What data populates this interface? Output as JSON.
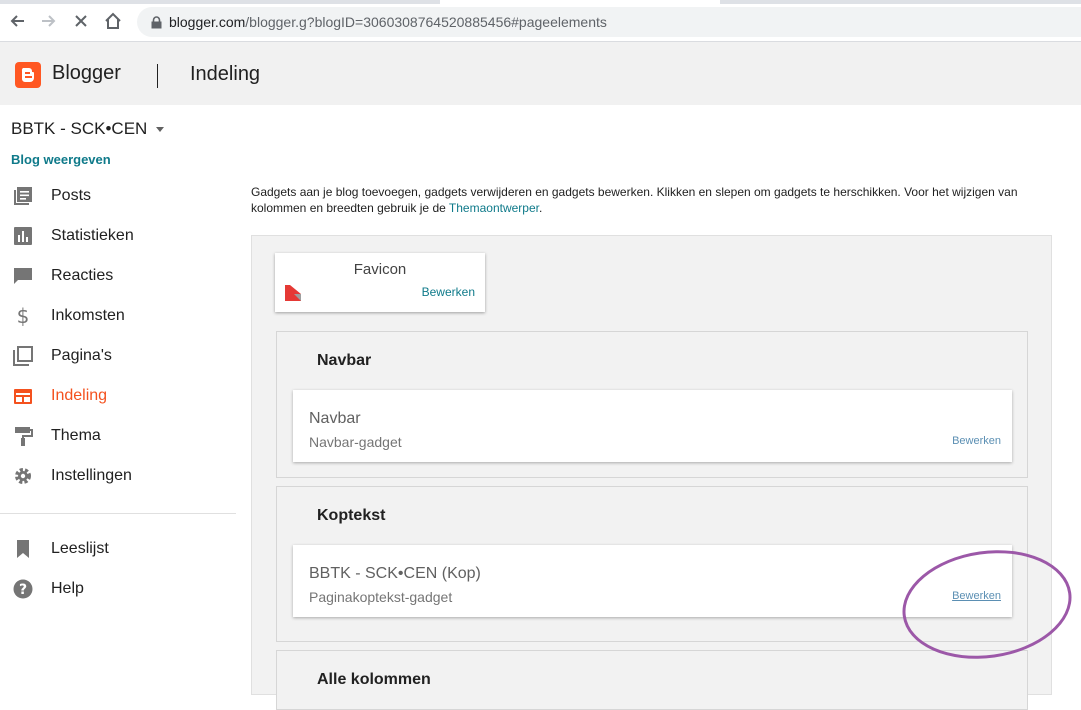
{
  "browser": {
    "url_host": "blogger.com",
    "url_path": "/blogger.g?blogID=3060308764520885456#pageelements",
    "icons": [
      "back-arrow-icon",
      "forward-arrow-icon",
      "stop-icon",
      "home-icon",
      "lock-icon"
    ]
  },
  "header": {
    "brand": "Blogger",
    "title": "Indeling"
  },
  "sidebar": {
    "blog_name": "BBTK - SCK•CEN",
    "view_blog": "Blog weergeven",
    "items": [
      {
        "label": "Posts",
        "icon": "posts-icon"
      },
      {
        "label": "Statistieken",
        "icon": "stats-icon"
      },
      {
        "label": "Reacties",
        "icon": "comments-icon"
      },
      {
        "label": "Inkomsten",
        "icon": "dollar-icon"
      },
      {
        "label": "Pagina's",
        "icon": "pages-icon"
      },
      {
        "label": "Indeling",
        "icon": "layout-icon",
        "active": true
      },
      {
        "label": "Thema",
        "icon": "paint-roller-icon"
      },
      {
        "label": "Instellingen",
        "icon": "gear-icon"
      }
    ],
    "secondary": [
      {
        "label": "Leeslijst",
        "icon": "bookmark-icon"
      },
      {
        "label": "Help",
        "icon": "help-icon"
      }
    ]
  },
  "main": {
    "intro_text": "Gadgets aan je blog toevoegen, gadgets verwijderen en gadgets bewerken. Klikken en slepen om gadgets te herschikken. Voor het wijzigen van kolommen en breedten gebruik je de",
    "intro_link": "Themaontwerper",
    "intro_end": ".",
    "favicon": {
      "title": "Favicon",
      "edit": "Bewerken"
    },
    "sections": [
      {
        "title": "Navbar",
        "gadget_title": "Navbar",
        "gadget_sub": "Navbar-gadget",
        "edit": "Bewerken"
      },
      {
        "title": "Koptekst",
        "gadget_title": "BBTK - SCK•CEN (Kop)",
        "gadget_sub": "Paginakoptekst-gadget",
        "edit": "Bewerken"
      },
      {
        "title": "Alle kolommen"
      }
    ]
  },
  "colors": {
    "accent": "#f4511e",
    "link": "#0f7a8a",
    "annotation": "#9c58a8"
  }
}
